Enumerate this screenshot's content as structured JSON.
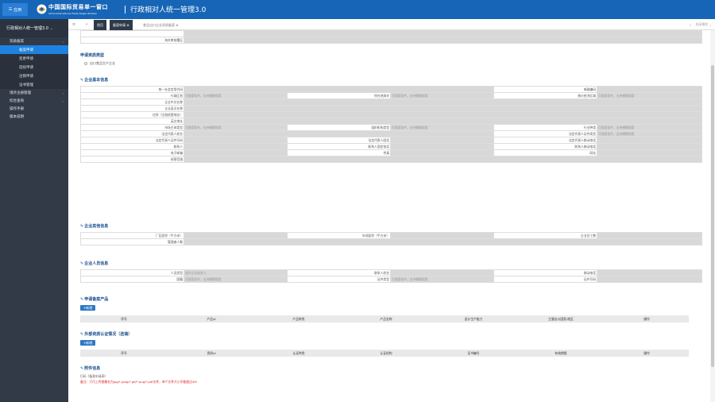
{
  "header": {
    "app_button": "应用",
    "brand_cn": "中国国际贸易单一窗口",
    "brand_en": "China International Trade Single Window",
    "system_title": "行政相对人统一管理3.0"
  },
  "sidebar": {
    "title": "行政相对人统一管理3.0",
    "groups": [
      {
        "label": "资质备案",
        "subs": [
          "备案申请",
          "变更申请",
          "延续申请",
          "注销申请",
          "证书管理"
        ]
      },
      {
        "label": "境外注册管理"
      },
      {
        "label": "综合查询"
      },
      {
        "label": "操作手册"
      },
      {
        "label": "版本说明"
      }
    ]
  },
  "tabs": {
    "home": "首页",
    "active": "备案申请",
    "other": "食品出口企业资质备案",
    "right": "关闭操作"
  },
  "form": {
    "customs_label": "海关审核署区",
    "apply_type_title": "申请资质类型",
    "apply_type_option": "出口食品生产企业",
    "placeholder": "可搜索条件，支持模糊搜索",
    "basic_title": "企业基本信息",
    "basic": {
      "uscc": "统一社会信用代码",
      "postcode": "邮政编码",
      "admin_area": "行政区划",
      "place": "所在地海关",
      "district": "统计经济区域",
      "name_cn": "企业中文名称",
      "name_en": "企业英文名称",
      "address_cn": "住所（注册经营地址）",
      "address_en": "英文地址",
      "market_type": "市场主体类型",
      "org_type": "组织机构类型",
      "industry": "行业种类",
      "legal_name": "法定代表人姓名",
      "legal_cert_type": "法定代表人证件类型",
      "legal_cert_no": "法定代表人证件号码",
      "legal_phone": "法定代表人固话",
      "legal_mobile": "法定代表人移动电话",
      "contact": "联系人",
      "contact_phone": "联系人固定电话",
      "contact_mobile": "联系人移动电话",
      "email": "电子邮箱",
      "fax": "传真",
      "website": "网址",
      "scope": "经营范围"
    },
    "other_title": "企业其他信息",
    "other": {
      "plant_area": "厂区面积（平方米）",
      "workshop_area": "车间面积（平方米）",
      "staff_total": "企业员工数",
      "managers": "管理者人数"
    },
    "personnel_title": "企业人员信息",
    "personnel": {
      "person_type": "人员类型",
      "person_type_value": "境外企业联系人",
      "contact_name": "联系人姓名",
      "mobile": "移动电话",
      "nationality": "国籍",
      "cert_type": "证件类型",
      "cert_no": "证件号码"
    },
    "products_title": "申请备案产品",
    "add_label": "+新增",
    "products_cols": [
      "序号",
      "产品id",
      "产品种类",
      "产品名称",
      "设计生产能力",
      "主要出口国家/地区",
      "操作"
    ],
    "cert_title": "外部资质认证情况（选填）",
    "cert_cols": [
      "序号",
      "资质id",
      "认证种类",
      "认证机构",
      "证书编号",
      "有效期限",
      "操作"
    ],
    "attach_title": "附件信息",
    "attach_line1": "扫码《备案申请表》",
    "attach_note": "备注：只可上传图像名为jpg/*.jpeg/*.gif/*.png/*.pdf文件，单个文件大小不能超过4M"
  },
  "colors": {
    "topbar": "#1665b7",
    "sidebar": "#323a48",
    "active": "#1e83e0",
    "section": "#1a4f8f",
    "note": "#e02020"
  }
}
